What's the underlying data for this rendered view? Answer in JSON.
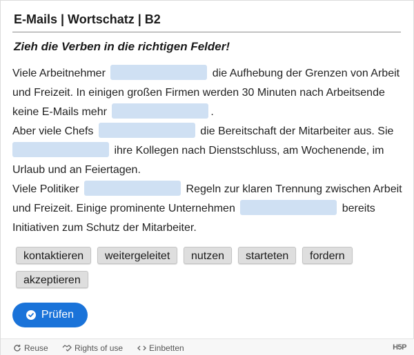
{
  "header": {
    "title": "E-Mails | Wortschatz | B2"
  },
  "task": {
    "instruction": "Zieh die Verben in die richtigen Felder!"
  },
  "text": {
    "p1_a": "Viele Arbeitnehmer",
    "p1_b": "die Aufhebung der Grenzen von Arbeit und Freizeit. In einigen großen Firmen werden 30 Minuten nach Arbeitsende keine E-Mails mehr",
    "p1_c": ".",
    "p2_a": "Aber viele Chefs",
    "p2_b": "die Bereitschaft der Mitarbeiter aus. Sie",
    "p2_c": "ihre Kollegen nach Dienstschluss, am Wochenende, im Urlaub und an Feiertagen.",
    "p3_a": "Viele Politiker",
    "p3_b": "Regeln zur klaren Trennung zwischen Arbeit und Freizeit. Einige prominente Unternehmen",
    "p3_c": "bereits Initiativen zum Schutz der Mitarbeiter."
  },
  "words": [
    "kontaktieren",
    "weitergeleitet",
    "nutzen",
    "starteten",
    "fordern",
    "akzeptieren"
  ],
  "buttons": {
    "check_label": "Prüfen"
  },
  "footer": {
    "reuse": "Reuse",
    "rights": "Rights of use",
    "embed": "Einbetten",
    "brand": "H5P"
  },
  "colors": {
    "accent": "#1a73d9",
    "dropzone": "#cfe0f3",
    "chip": "#dedede"
  }
}
